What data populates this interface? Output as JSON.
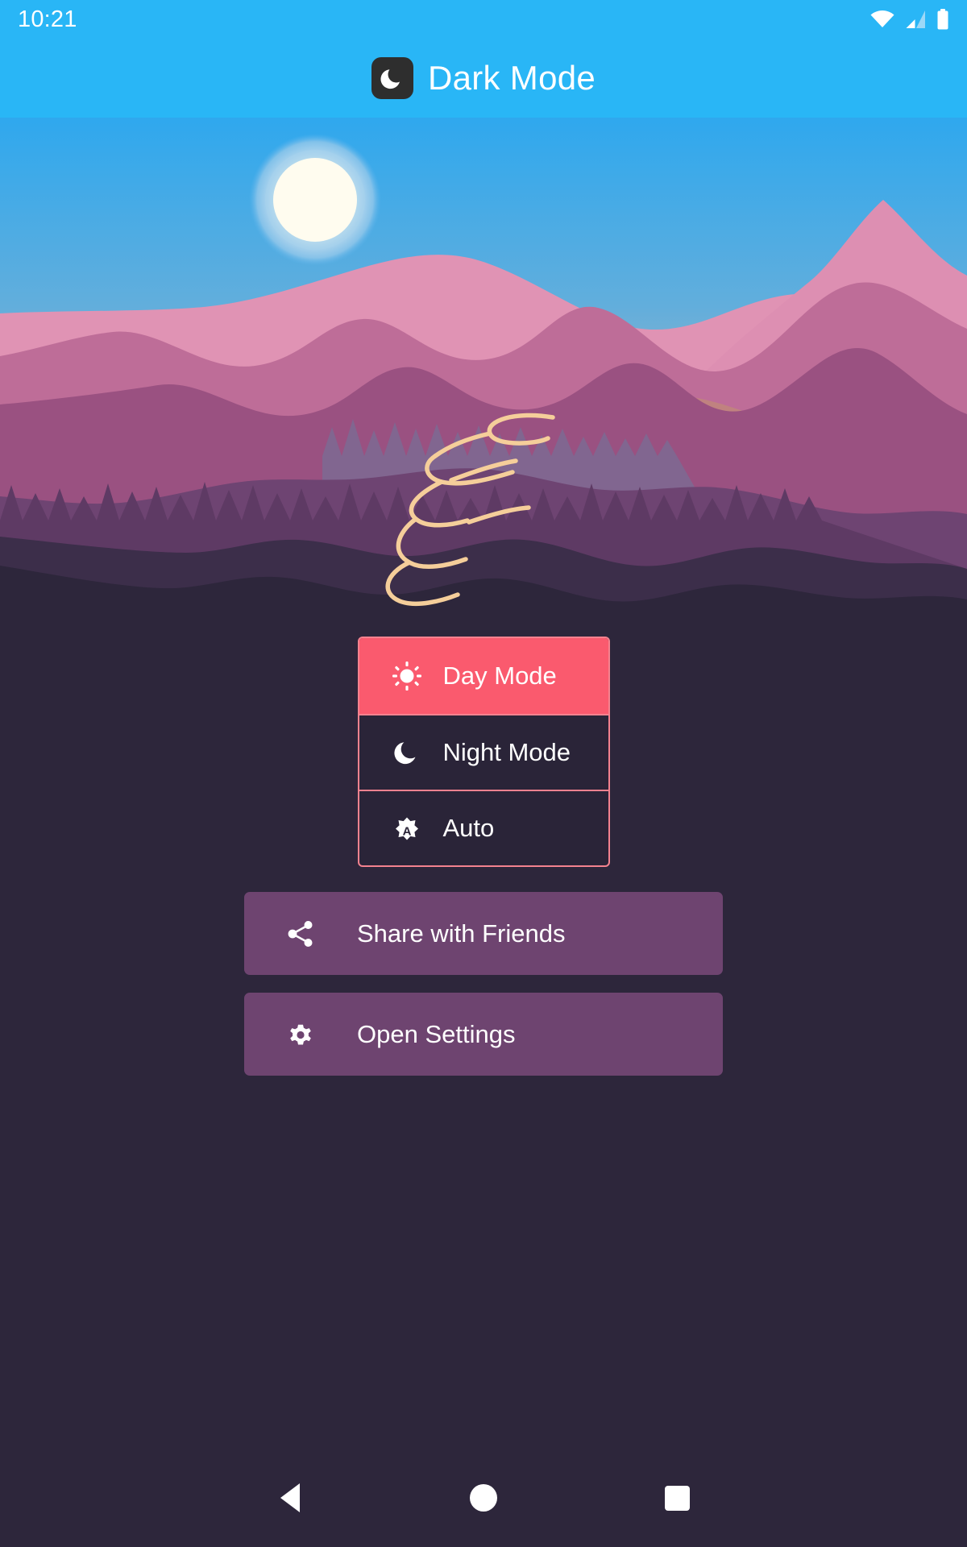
{
  "statusbar": {
    "time": "10:21",
    "icons": [
      "wifi-icon",
      "cellular-signal-icon",
      "battery-icon"
    ]
  },
  "appbar": {
    "icon": "moon-icon",
    "title": "Dark Mode",
    "background_color": "#29B6F6"
  },
  "hero": {
    "name": "mountain-landscape-illustration",
    "sun": "sun-graphic",
    "birds_count": 3,
    "sky_top_color": "#2FA8EE",
    "sky_bottom_color": "#C8C0B0"
  },
  "mode_selector": {
    "border_color": "#F4828F",
    "selected_color": "#FA5A6E",
    "unselected_color": "#2A2438",
    "selected_index": 0,
    "options": [
      {
        "label": "Day Mode",
        "icon": "sun-icon",
        "selected": true
      },
      {
        "label": "Night Mode",
        "icon": "crescent-moon-icon",
        "selected": false
      },
      {
        "label": "Auto",
        "icon": "auto-brightness-icon",
        "selected": false
      }
    ]
  },
  "actions": {
    "button_color": "#6E4470",
    "items": [
      {
        "label": "Share with Friends",
        "icon": "share-icon"
      },
      {
        "label": "Open Settings",
        "icon": "gear-icon"
      }
    ]
  },
  "navbar": {
    "background_color": "#2D263B",
    "buttons": [
      {
        "name": "back-button",
        "icon": "triangle-left-icon"
      },
      {
        "name": "home-button",
        "icon": "circle-icon"
      },
      {
        "name": "recents-button",
        "icon": "square-icon"
      }
    ]
  },
  "theme": {
    "page_background": "#2D263B",
    "accent": "#FA5A6E",
    "text_color": "#FFFFFF"
  }
}
